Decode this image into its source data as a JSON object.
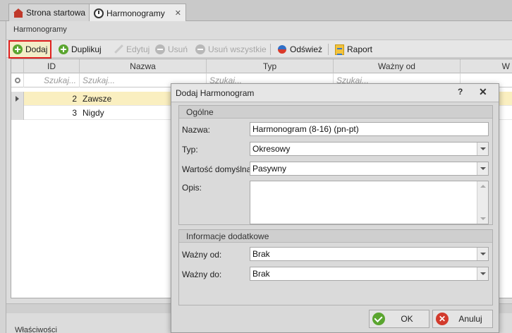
{
  "tabs": [
    {
      "label": "Strona startowa",
      "icon": "home-icon"
    },
    {
      "label": "Harmonogramy",
      "icon": "clock-icon"
    }
  ],
  "panel": {
    "title": "Harmonogramy"
  },
  "toolbar": {
    "add": "Dodaj",
    "duplicate": "Duplikuj",
    "edit": "Edytuj",
    "delete": "Usuń",
    "delete_all": "Usuń wszystkie",
    "refresh": "Odśwież",
    "report": "Raport"
  },
  "grid": {
    "columns": [
      "ID",
      "Nazwa",
      "Typ",
      "Ważny od",
      "W"
    ],
    "filter_placeholders": [
      "Szukaj...",
      "Szukaj...",
      "Szukaj...",
      "Szukaj..."
    ],
    "rows": [
      {
        "id": "2",
        "name": "Zawsze"
      },
      {
        "id": "3",
        "name": "Nigdy"
      }
    ]
  },
  "bottom": {
    "label": "Właściwości"
  },
  "dialog": {
    "title": "Dodaj Harmonogram",
    "help": "?",
    "close": "✕",
    "general": {
      "header": "Ogólne",
      "name_label": "Nazwa:",
      "name_value": "Harmonogram (8-16) (pn-pt)",
      "type_label": "Typ:",
      "type_value": "Okresowy",
      "default_label": "Wartość domyślna:",
      "default_value": "Pasywny",
      "desc_label": "Opis:"
    },
    "extra": {
      "header": "Informacje dodatkowe",
      "valid_from_label": "Ważny od:",
      "valid_from_value": "Brak",
      "valid_to_label": "Ważny do:",
      "valid_to_value": "Brak"
    },
    "ok": "OK",
    "cancel": "Anuluj"
  },
  "colors": {
    "highlight": "#e0201f",
    "selected_row": "#faefc0",
    "ok": "#5aa52f",
    "cancel": "#d23a2c"
  }
}
